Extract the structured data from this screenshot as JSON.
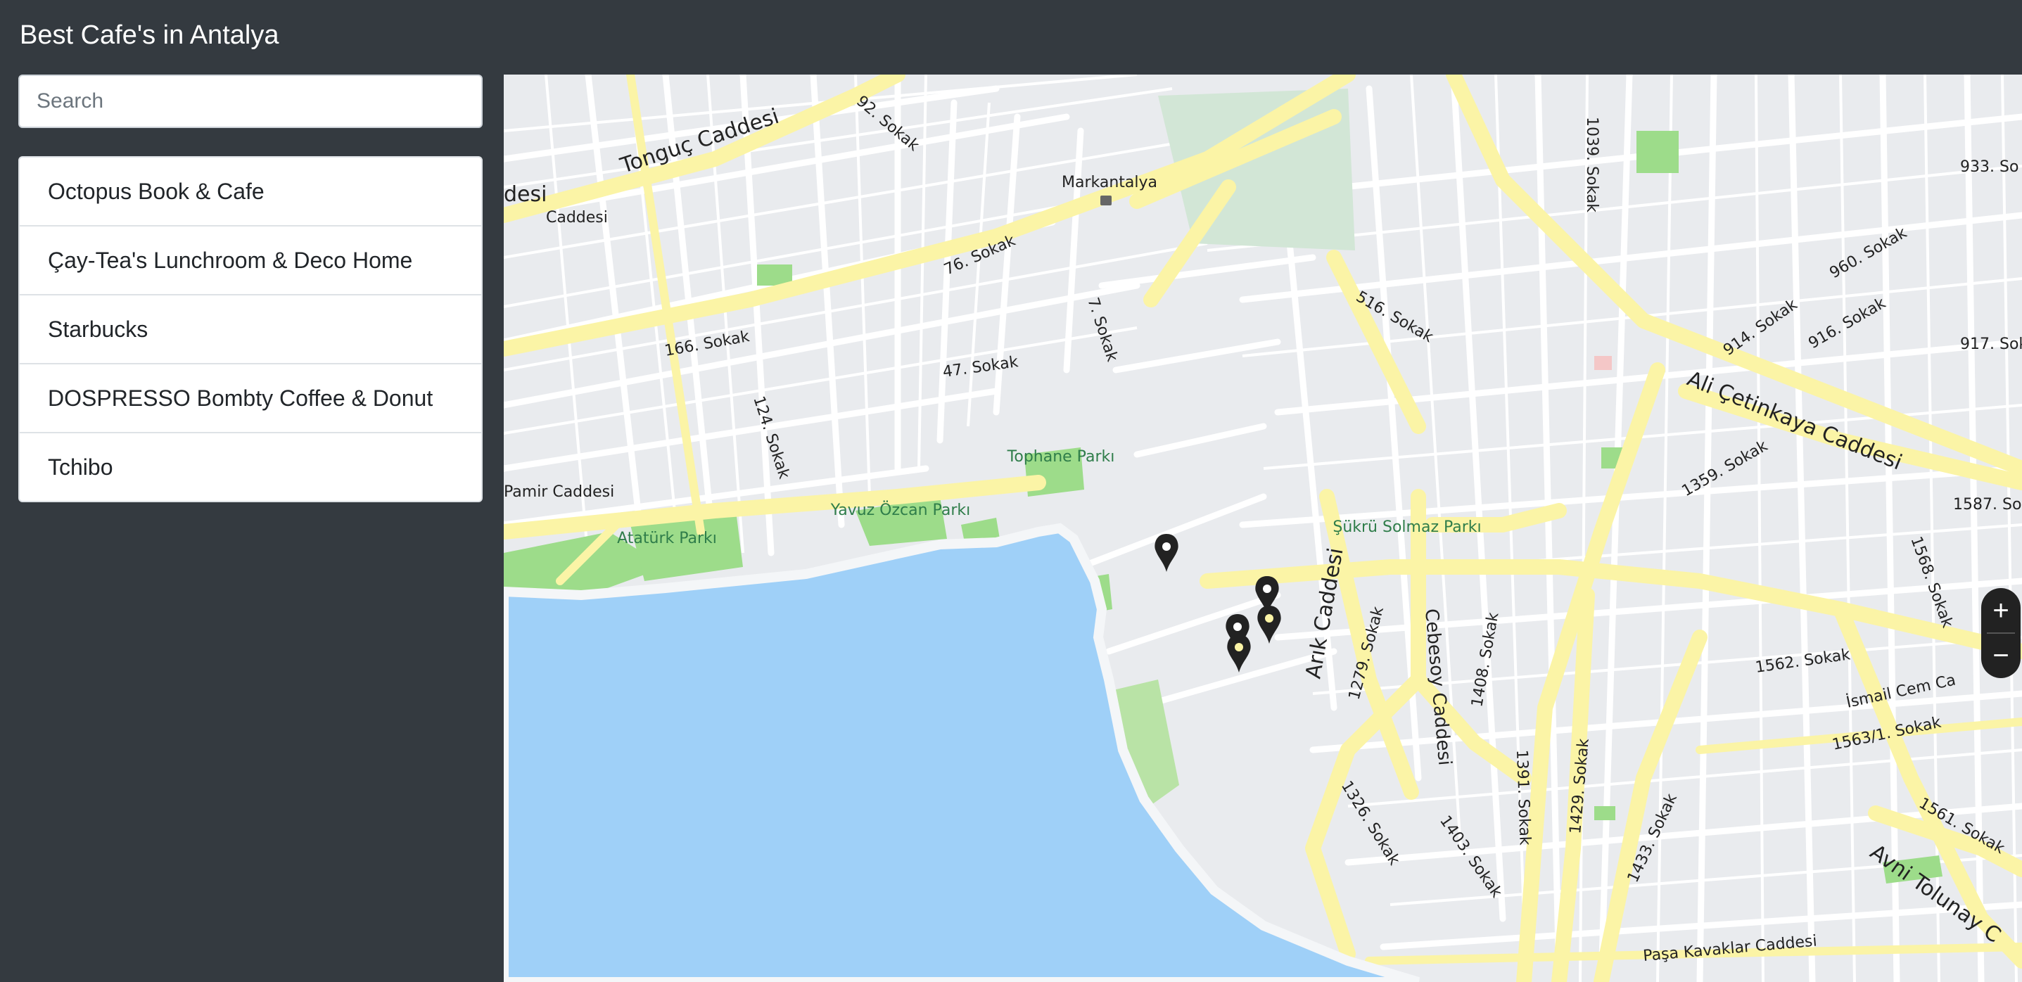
{
  "header": {
    "title": "Best Cafe's in Antalya"
  },
  "search": {
    "placeholder": "Search",
    "value": ""
  },
  "cafes": [
    {
      "name": "Octopus Book & Cafe"
    },
    {
      "name": "Çay-Tea's Lunchroom & Deco Home"
    },
    {
      "name": "Starbucks"
    },
    {
      "name": "DOSPRESSO Bombty Coffee & Donut"
    },
    {
      "name": "Tchibo"
    }
  ],
  "map": {
    "zoom_in_label": "+",
    "zoom_out_label": "−",
    "street_labels": {
      "tonguc": "Tonguç Caddesi",
      "caddesi_left": "Caddesi",
      "desi": "desi",
      "sokak_92": "92. Sokak",
      "sokak_76": "76. Sokak",
      "sokak_7": "7. Sokak",
      "sokak_166": "166. Sokak",
      "sokak_47": "47. Sokak",
      "sokak_124": "124. Sokak",
      "pamir": "Pamir Caddesi",
      "sokak_516": "516. Sokak",
      "sokak_1039": "1039. Sokak",
      "sokak_960": "960. Sokak",
      "sokak_914": "914. Sokak",
      "sokak_916": "916. Sokak",
      "sokak_917": "917. Sok",
      "sokak_933": "933. So",
      "ali_cetinkaya": "Ali Çetinkaya Caddesi",
      "sokak_1359": "1359. Sokak",
      "sokak_1587": "1587. So",
      "sokak_1568": "1568. Sokak",
      "arik": "Arık Caddesi",
      "sokak_1279": "1279. Sokak",
      "cebesoy": "Cebesoy Caddesi",
      "sokak_1408": "1408. Sokak",
      "sokak_1391": "1391. Sokak",
      "sokak_1429": "1429. Sokak",
      "sokak_1433": "1433. Sokak",
      "sokak_1562": "1562. Sokak",
      "ismail_cem": "İsmail Cem Ca",
      "sokak_1563": "1563/1. Sokak",
      "sokak_1561": "1561. Sokak",
      "sokak_1326": "1326. Sokak",
      "sokak_1403": "1403. Sokak",
      "avni_tolunay": "Avni Tolunay C",
      "pasa_kavaklar": "Paşa Kavaklar Caddesi",
      "markantalya": "Markantalya"
    },
    "parks": {
      "tophane": "Tophane Parkı",
      "yavuz_ozcan": "Yavuz Özcan Parkı",
      "ataturk": "Atatürk Parkı",
      "sukru_solmaz": "Şükrü Solmaz Parkı"
    },
    "colors": {
      "land": "#e9ebee",
      "street": "#ffffff",
      "main_road": "#fbf4a6",
      "water": "#9fd0f8",
      "park": "#9ddc8a",
      "marker": "#222222"
    }
  }
}
